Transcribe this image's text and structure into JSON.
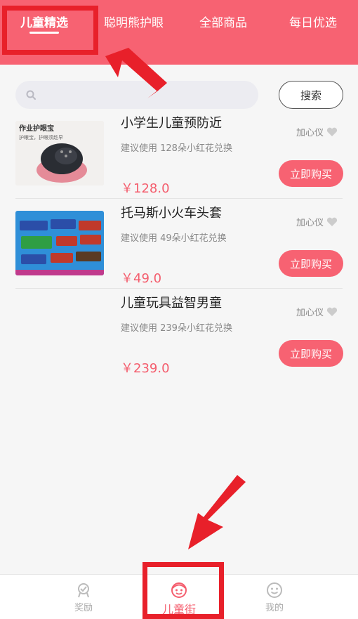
{
  "top_tabs": [
    {
      "label": "儿童精选",
      "active": true
    },
    {
      "label": "聪明熊护眼",
      "active": false
    },
    {
      "label": "全部商品",
      "active": false
    },
    {
      "label": "每日优选",
      "active": false
    }
  ],
  "search": {
    "placeholder": "",
    "button_label": "搜索"
  },
  "products": [
    {
      "title": "小学生儿童预防近",
      "subtitle": "建议使用 128朵小红花兑换",
      "price": "￥128.0",
      "fav_label": "加心仪",
      "buy_label": "立即购买",
      "img_caption": "作业护眼宝",
      "img_sub": "护眼宝，护眼须趁早"
    },
    {
      "title": "托马斯小火车头套",
      "subtitle": "建议使用 49朵小红花兑换",
      "price": "￥49.0",
      "fav_label": "加心仪",
      "buy_label": "立即购买"
    },
    {
      "title": "儿童玩具益智男童",
      "subtitle": "建议使用 239朵小红花兑换",
      "price": "￥239.0",
      "fav_label": "加心仪",
      "buy_label": "立即购买"
    }
  ],
  "bottom_nav": [
    {
      "label": "奖励",
      "icon": "medal-icon",
      "active": false
    },
    {
      "label": "儿童街",
      "icon": "child-face-icon",
      "active": true
    },
    {
      "label": "我的",
      "icon": "smiley-icon",
      "active": false
    }
  ],
  "colors": {
    "accent": "#f76272",
    "price": "#f45d6d",
    "annotation": "#e8202a"
  }
}
